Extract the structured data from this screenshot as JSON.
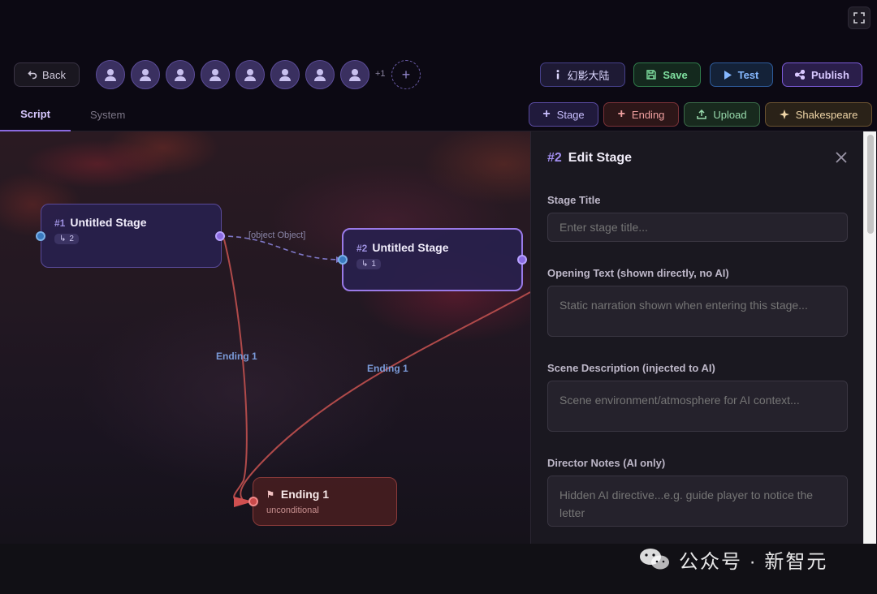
{
  "toolbar": {
    "back_label": "Back",
    "avatars_extra": "+1",
    "add_avatar": "+",
    "world_label": "幻影大陆",
    "save_label": "Save",
    "test_label": "Test",
    "publish_label": "Publish"
  },
  "tabs": [
    "Script",
    "System"
  ],
  "actions": {
    "stage_label": "Stage",
    "ending_label": "Ending",
    "upload_label": "Upload",
    "shakespeare_label": "Shakespeare"
  },
  "nodes": {
    "stage1": {
      "num": "#1",
      "title": "Untitled Stage",
      "count": "2"
    },
    "stage2": {
      "num": "#2",
      "title": "Untitled Stage",
      "count": "1"
    },
    "ending1": {
      "title": "Ending 1",
      "subtitle": "unconditional"
    }
  },
  "edges": {
    "dashed_label": "[object Object]",
    "ending_label_1": "Ending 1",
    "ending_label_2": "Ending 1"
  },
  "panel": {
    "num": "#2",
    "title": "Edit Stage",
    "fields": {
      "stage_title": {
        "label": "Stage Title",
        "placeholder": "Enter stage title..."
      },
      "opening_text": {
        "label": "Opening Text (shown directly, no AI)",
        "placeholder": "Static narration shown when entering this stage..."
      },
      "scene_desc": {
        "label": "Scene Description (injected to AI)",
        "placeholder": "Scene environment/atmosphere for AI context..."
      },
      "director_notes": {
        "label": "Director Notes (AI only)",
        "placeholder": "Hidden AI directive...e.g. guide player to notice the letter"
      }
    }
  },
  "watermark": "公众号 · 新智元",
  "colors": {
    "accent_purple": "#8a6ae0",
    "ending_red": "#c84a4a",
    "save_green": "#7fe0a0",
    "test_blue": "#86b8ff"
  }
}
